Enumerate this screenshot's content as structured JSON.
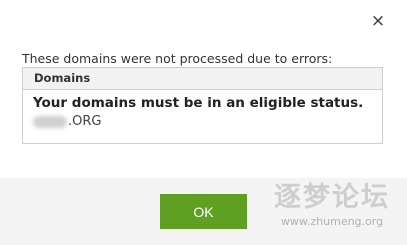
{
  "dialog": {
    "close_icon": "×",
    "message": "These domains were not processed due to errors:",
    "table": {
      "header": "Domains",
      "error_title": "Your domains must be in an eligible status.",
      "domain_suffix": ".ORG"
    },
    "ok_label": "OK"
  },
  "watermark": {
    "text": "逐梦论坛",
    "url": "www.zhumeng.org"
  },
  "colors": {
    "ok_button": "#5f9f22",
    "footer_bg": "#f4f4f4",
    "table_header_bg": "#f2f2f2"
  }
}
